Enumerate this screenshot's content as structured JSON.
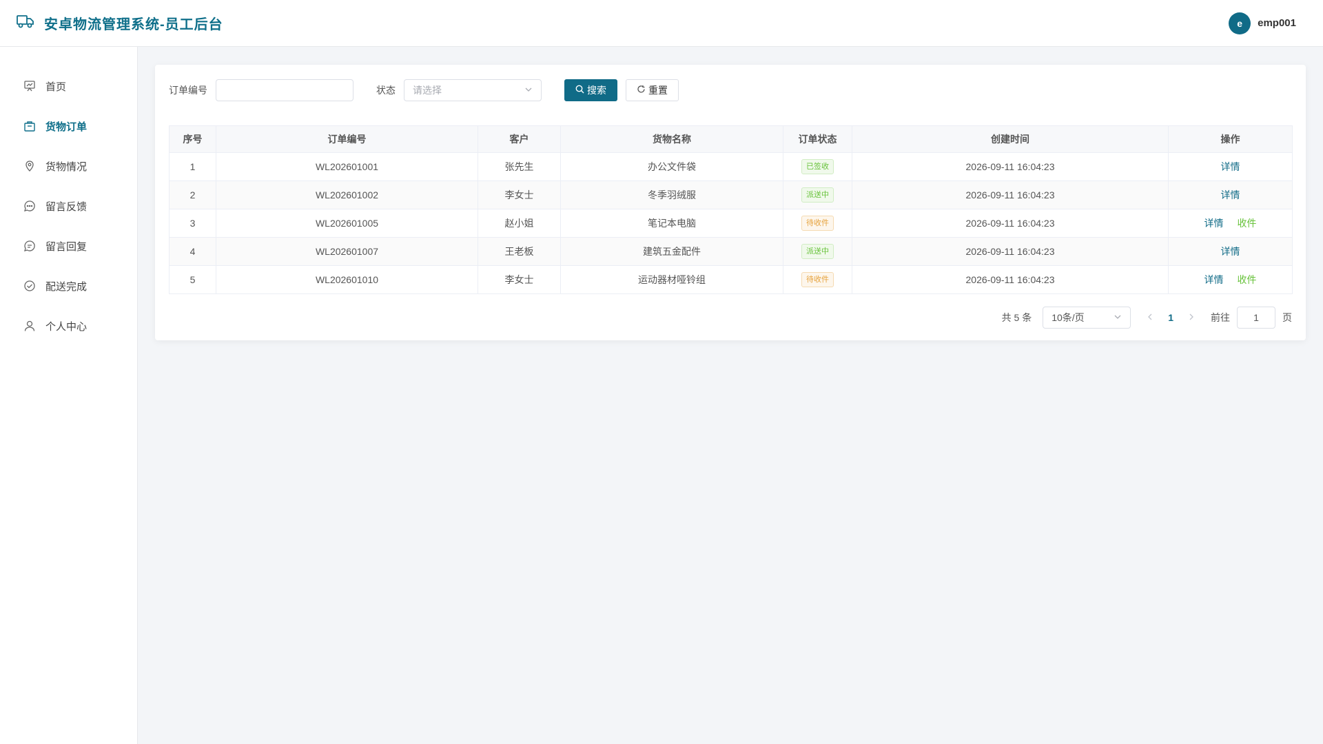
{
  "header": {
    "title": "安卓物流管理系统-员工后台",
    "avatar_letter": "e",
    "username": "emp001"
  },
  "sidebar": {
    "items": [
      {
        "label": "首页",
        "icon": "monitor-icon"
      },
      {
        "label": "货物订单",
        "icon": "package-icon",
        "active": true
      },
      {
        "label": "货物情况",
        "icon": "location-pin-icon"
      },
      {
        "label": "留言反馈",
        "icon": "chat-bubble-icon"
      },
      {
        "label": "留言回复",
        "icon": "chat-reply-icon"
      },
      {
        "label": "配送完成",
        "icon": "check-circle-icon"
      },
      {
        "label": "个人中心",
        "icon": "user-icon"
      }
    ]
  },
  "search": {
    "order_no_label": "订单编号",
    "order_no_value": "",
    "status_label": "状态",
    "status_placeholder": "请选择",
    "search_button": "搜索",
    "reset_button": "重置"
  },
  "table": {
    "headers": [
      "序号",
      "订单编号",
      "客户",
      "货物名称",
      "订单状态",
      "创建时间",
      "操作"
    ],
    "rows": [
      {
        "no": "1",
        "order": "WL202601001",
        "customer": "张先生",
        "goods": "办公文件袋",
        "status": "已签收",
        "status_type": "success",
        "time": "2026-09-11 16:04:23",
        "actions": [
          "详情"
        ]
      },
      {
        "no": "2",
        "order": "WL202601002",
        "customer": "李女士",
        "goods": "冬季羽绒服",
        "status": "派送中",
        "status_type": "success",
        "time": "2026-09-11 16:04:23",
        "actions": [
          "详情"
        ]
      },
      {
        "no": "3",
        "order": "WL202601005",
        "customer": "赵小姐",
        "goods": "笔记本电脑",
        "status": "待收件",
        "status_type": "warning",
        "time": "2026-09-11 16:04:23",
        "actions": [
          "详情",
          "收件"
        ]
      },
      {
        "no": "4",
        "order": "WL202601007",
        "customer": "王老板",
        "goods": "建筑五金配件",
        "status": "派送中",
        "status_type": "success",
        "time": "2026-09-11 16:04:23",
        "actions": [
          "详情"
        ]
      },
      {
        "no": "5",
        "order": "WL202601010",
        "customer": "李女士",
        "goods": "运动器材哑铃组",
        "status": "待收件",
        "status_type": "warning",
        "time": "2026-09-11 16:04:23",
        "actions": [
          "详情",
          "收件"
        ]
      }
    ]
  },
  "pagination": {
    "total_text": "共 5 条",
    "page_size": "10条/页",
    "current_page": "1",
    "goto_label": "前往",
    "goto_value": "1",
    "page_suffix": "页"
  },
  "colors": {
    "primary": "#106b87",
    "success": "#67c23a",
    "warning": "#e6a23c"
  }
}
